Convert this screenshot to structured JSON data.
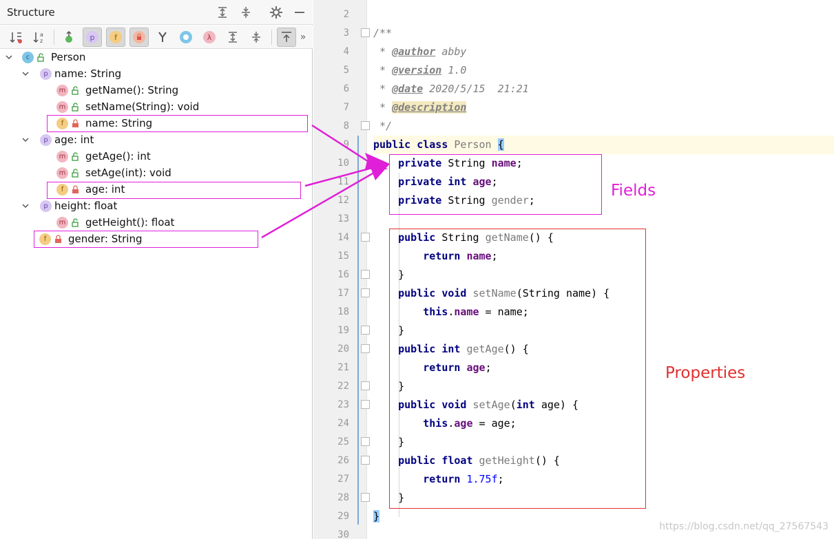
{
  "structure": {
    "title": "Structure",
    "tree": [
      {
        "label": "Person",
        "badge": "c"
      },
      {
        "label": "name: String",
        "badge": "p"
      },
      {
        "label": "getName(): String",
        "badge": "m"
      },
      {
        "label": "setName(String): void",
        "badge": "m"
      },
      {
        "label": "name: String",
        "badge": "f"
      },
      {
        "label": "age: int",
        "badge": "p"
      },
      {
        "label": "getAge(): int",
        "badge": "m"
      },
      {
        "label": "setAge(int): void",
        "badge": "m"
      },
      {
        "label": "age: int",
        "badge": "f"
      },
      {
        "label": "height: float",
        "badge": "p"
      },
      {
        "label": "getHeight(): float",
        "badge": "m"
      },
      {
        "label": "gender: String",
        "badge": "f"
      }
    ]
  },
  "editor": {
    "line_numbers": [
      "2",
      "3",
      "4",
      "5",
      "6",
      "7",
      "8",
      "9",
      "10",
      "11",
      "12",
      "13",
      "14",
      "15",
      "16",
      "17",
      "18",
      "19",
      "20",
      "21",
      "22",
      "23",
      "24",
      "25",
      "26",
      "27",
      "28",
      "29",
      "30"
    ],
    "doc": {
      "open": "/**",
      "author_tag": "@author",
      "author_val": " abby",
      "version_tag": "@version",
      "version_val": " 1.0",
      "date_tag": "@date",
      "date_val": " 2020/5/15  21:21",
      "desc_tag": "@description",
      "close": " */"
    },
    "code": {
      "public": "public",
      "class": "class",
      "class_name": " Person ",
      "private": "private",
      "string": " String ",
      "int": "int",
      "float": "float",
      "void": "void",
      "return": "return",
      "this": "this",
      "f_name": "name",
      "f_age": "age",
      "f_gender": "gender",
      "getName": "getName",
      "setName": "setName",
      "getAge": "getAge",
      "setAge": "setAge",
      "getHeight": "getHeight",
      "num": "1.75f"
    },
    "fields_label": "Fields",
    "properties_label": "Properties",
    "watermark": "https://blog.csdn.net/qq_27567543"
  }
}
